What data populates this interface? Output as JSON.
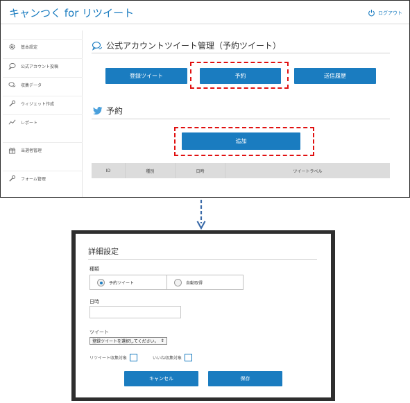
{
  "header": {
    "app_title": "キャンつく for リツイート",
    "logout_label": "ログアウト"
  },
  "sidebar": {
    "items": [
      {
        "label": "基本設定",
        "icon": "gear-icon"
      },
      {
        "label": "公式アカウント投稿",
        "icon": "speech-bubble-icon"
      },
      {
        "label": "収集データ",
        "icon": "chat-bubbles-icon"
      },
      {
        "label": "ウィジェット作成",
        "icon": "wrench-icon"
      },
      {
        "label": "レポート",
        "icon": "line-chart-icon"
      },
      {
        "label": "当選者管理",
        "icon": "gift-icon"
      },
      {
        "label": "フォーム管理",
        "icon": "wrench-icon"
      }
    ]
  },
  "main": {
    "section_title": "公式アカウントツイート管理（予約ツイート）",
    "tabs": [
      {
        "label": "登録ツイート"
      },
      {
        "label": "予約"
      },
      {
        "label": "送信履歴"
      }
    ],
    "subsection_title": "予約",
    "add_button": "追加",
    "table_columns": [
      "ID",
      "種別",
      "日時",
      "ツイートラベル"
    ]
  },
  "modal": {
    "title": "詳細設定",
    "type_label": "種類",
    "type_options": [
      "予約ツイート",
      "自動取得"
    ],
    "selected_type": "予約ツイート",
    "date_label": "日時",
    "date_value": "",
    "tweet_label": "ツイート",
    "tweet_select_value": "登録ツイートを選択してください。",
    "retweet_target_label": "リツイート収集対象",
    "like_target_label": "いいね収集対象",
    "cancel_button": "キャンセル",
    "save_button": "保存"
  },
  "colors": {
    "accent": "#1a7cc0",
    "highlight": "#e01010"
  }
}
